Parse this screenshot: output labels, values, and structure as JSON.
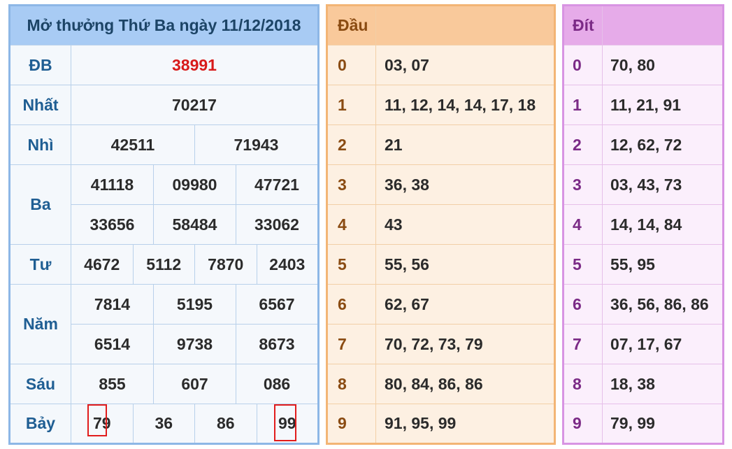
{
  "results": {
    "title": "Mở thưởng Thứ Ba ngày 11/12/2018",
    "db": {
      "label": "ĐB",
      "values": [
        "38991"
      ]
    },
    "nhat": {
      "label": "Nhất",
      "values": [
        "70217"
      ]
    },
    "nhi": {
      "label": "Nhì",
      "values": [
        "42511",
        "71943"
      ]
    },
    "ba": {
      "label": "Ba",
      "values": [
        "41118",
        "09980",
        "47721",
        "33656",
        "58484",
        "33062"
      ]
    },
    "tu": {
      "label": "Tư",
      "values": [
        "4672",
        "5112",
        "7870",
        "2403"
      ]
    },
    "nam": {
      "label": "Năm",
      "values": [
        "7814",
        "5195",
        "6567",
        "6514",
        "9738",
        "8673"
      ]
    },
    "sau": {
      "label": "Sáu",
      "values": [
        "855",
        "607",
        "086"
      ]
    },
    "bay": {
      "label": "Bảy",
      "values": [
        "79",
        "36",
        "86",
        "99"
      ]
    }
  },
  "dau": {
    "header": "Đầu",
    "rows": [
      {
        "digit": "0",
        "list": "03, 07"
      },
      {
        "digit": "1",
        "list": "11, 12, 14, 14, 17, 18"
      },
      {
        "digit": "2",
        "list": "21"
      },
      {
        "digit": "3",
        "list": "36, 38"
      },
      {
        "digit": "4",
        "list": "43"
      },
      {
        "digit": "5",
        "list": "55, 56"
      },
      {
        "digit": "6",
        "list": "62, 67"
      },
      {
        "digit": "7",
        "list": "70, 72, 73, 79"
      },
      {
        "digit": "8",
        "list": "80, 84, 86, 86"
      },
      {
        "digit": "9",
        "list": "91, 95, 99"
      }
    ]
  },
  "dit": {
    "header": "Đít",
    "rows": [
      {
        "digit": "0",
        "list": "70, 80"
      },
      {
        "digit": "1",
        "list": "11, 21, 91"
      },
      {
        "digit": "2",
        "list": "12, 62, 72"
      },
      {
        "digit": "3",
        "list": "03, 43, 73"
      },
      {
        "digit": "4",
        "list": "14, 14, 84"
      },
      {
        "digit": "5",
        "list": "55, 95"
      },
      {
        "digit": "6",
        "list": "36, 56, 86, 86"
      },
      {
        "digit": "7",
        "list": "07, 17, 67"
      },
      {
        "digit": "8",
        "list": "18, 38"
      },
      {
        "digit": "9",
        "list": "79, 99"
      }
    ]
  },
  "colors": {
    "special_prize": "#d81a1a",
    "highlight_box": "#e11c1c",
    "results_border": "#8db7e6",
    "dau_border": "#f3b575",
    "dit_border": "#d894e3"
  }
}
